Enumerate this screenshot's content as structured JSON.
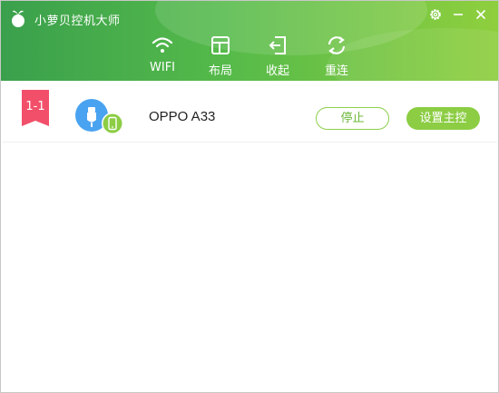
{
  "app": {
    "title": "小萝贝控机大师"
  },
  "window_controls": {
    "settings": "gear-icon",
    "minimize": "minimize-icon",
    "close": "close-icon"
  },
  "toolbar": {
    "items": [
      {
        "label": "WIFI",
        "icon": "wifi-icon"
      },
      {
        "label": "布局",
        "icon": "layout-icon"
      },
      {
        "label": "收起",
        "icon": "collapse-icon"
      },
      {
        "label": "重连",
        "icon": "reconnect-icon"
      }
    ]
  },
  "devices": [
    {
      "index": "1-1",
      "name": "OPPO A33",
      "connection_icon": "usb-icon",
      "device_icon": "phone-icon",
      "stop_label": "停止",
      "set_master_label": "设置主控"
    }
  ],
  "colors": {
    "header_start": "#3aa04c",
    "header_end": "#8fcf3e",
    "badge": "#f2506a",
    "usb_blue": "#4aa3f0",
    "accent_green": "#8ccd44"
  }
}
